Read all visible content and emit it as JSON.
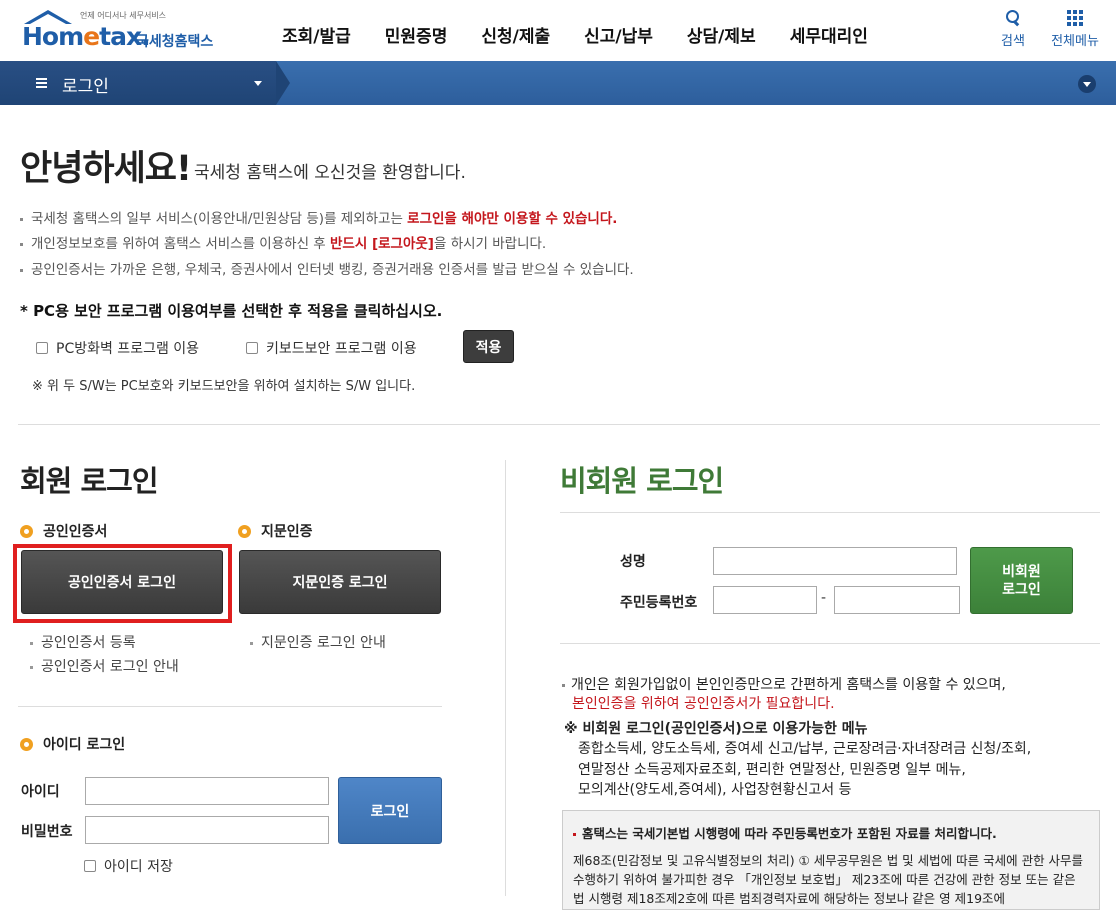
{
  "header": {
    "logo_tagline": "언제 어디서나 세무서비스",
    "logo_brand": "Hom",
    "logo_brand_e": "e",
    "logo_brand_rest": "tax.",
    "logo_kr": "국세청홈택스",
    "menu": [
      "조회/발급",
      "민원증명",
      "신청/제출",
      "신고/납부",
      "상담/제보",
      "세무대리인"
    ],
    "search_label": "검색",
    "all_menu_label": "전체메뉴"
  },
  "locbar": {
    "current": "로그인"
  },
  "welcome": {
    "title": "안녕하세요!",
    "subtitle": "국세청 홈택스에 오신것을 환영합니다.",
    "notices": [
      {
        "text": "국세청 홈택스의 일부 서비스(이용안내/민원상담 등)를 제외하고는 ",
        "em": "로그인을 해야만 이용할 수 있습니다.",
        "tail": ""
      },
      {
        "text": "개인정보보호를 위하여 홈택스 서비스를 이용하신 후 ",
        "em": "반드시 [로그아웃]",
        "tail": "을 하시기 바랍니다."
      },
      {
        "text": "공인인증서는 가까운 은행, 우체국, 증권사에서 인터넷 뱅킹, 증권거래용 인증서를 발급 받으실 수 있습니다.",
        "em": "",
        "tail": ""
      }
    ],
    "security_question": "* PC용 보안 프로그램 이용여부를 선택한 후 적용을 클릭하십시오.",
    "option_firewall": "PC방화벽 프로그램 이용",
    "option_keyboard": "키보드보안 프로그램 이용",
    "apply_label": "적용",
    "sw_note": "※ 위 두 S/W는 PC보호와 키보드보안을 위하여 설치하는 S/W 입니다."
  },
  "member": {
    "title": "회원 로그인",
    "cert_heading": "공인인증서",
    "finger_heading": "지문인증",
    "cert_button": "공인인증서 로그인",
    "finger_button": "지문인증 로그인",
    "cert_links": [
      "공인인증서 등록",
      "공인인증서 로그인 안내"
    ],
    "finger_link": "지문인증 로그인 안내",
    "id_heading": "아이디 로그인",
    "id_label": "아이디",
    "pw_label": "비밀번호",
    "login_button": "로그인",
    "save_id": "아이디 저장"
  },
  "guest": {
    "title": "비회원 로그인",
    "name_label": "성명",
    "rrn_label": "주민등록번호",
    "rrn_dash": "-",
    "login_button": "비회원\n로그인",
    "desc1": "개인은 회원가입없이 본인인증만으로 간편하게 홈택스를 이용할 수 있으며,",
    "desc2": "본인인증을 위하여 공인인증서가 필요합니다.",
    "menu_heading": "※ 비회원 로그인(공인인증서)으로 이용가능한 메뉴",
    "menu_line1": "종합소득세, 양도소득세, 증여세 신고/납부, 근로장려금·자녀장려금 신청/조회,",
    "menu_line2": "연말정산 소득공제자료조회, 편리한 연말정산, 민원증명 일부 메뉴,",
    "menu_line3": "모의계산(양도세,증여세), 사업장현황신고서 등",
    "info_title": "홈택스는 국세기본법 시행령에 따라 주민등록번호가 포함된 자료를 처리합니다.",
    "info_body": "제68조(민감정보 및 고유식별정보의 처리) ① 세무공무원은 법 및 세법에 따른 국세에 관한 사무를 수행하기 위하여 불가피한 경우 「개인정보 보호법」 제23조에 따른 건강에 관한 정보 또는 같은 법 시행령 제18조제2호에 따른 범죄경력자료에 해당하는 정보나 같은 영 제19조에"
  },
  "colors": {
    "brand_blue": "#1f5ea8",
    "guest_green": "#3f7a37",
    "alert_red": "#c4161c",
    "highlight_red": "#e01f1f"
  }
}
